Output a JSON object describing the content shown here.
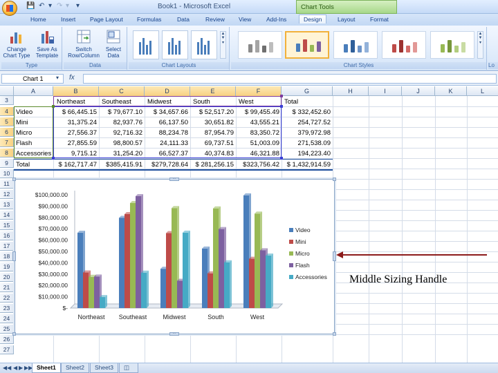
{
  "window": {
    "title": "Book1 - Microsoft Excel",
    "context_tab_group": "Chart Tools"
  },
  "ribbon_tabs": [
    "Home",
    "Insert",
    "Page Layout",
    "Formulas",
    "Data",
    "Review",
    "View",
    "Add-Ins",
    "Design",
    "Layout",
    "Format"
  ],
  "active_tab": "Design",
  "ribbon": {
    "type_group": {
      "label": "Type",
      "change_chart_type": "Change Chart Type",
      "save_as_template": "Save As Template"
    },
    "data_group": {
      "label": "Data",
      "switch_row_column": "Switch Row/Column",
      "select_data": "Select Data"
    },
    "chart_layouts_label": "Chart Layouts",
    "chart_styles_label": "Chart Styles",
    "cut_off_label": "Lo"
  },
  "formula_bar": {
    "name_box": "Chart 1",
    "formula": ""
  },
  "columns": [
    "A",
    "B",
    "C",
    "D",
    "E",
    "F",
    "G",
    "H",
    "I",
    "J",
    "K",
    "L"
  ],
  "rows": [
    "3",
    "4",
    "5",
    "6",
    "7",
    "8",
    "9",
    "10",
    "11",
    "12",
    "13",
    "14",
    "15",
    "16",
    "17",
    "18",
    "19",
    "20",
    "21",
    "22",
    "23",
    "24",
    "25",
    "26",
    "27"
  ],
  "table": {
    "headers": [
      "Northeast",
      "Southeast",
      "Midwest",
      "South",
      "West",
      "Total"
    ],
    "rows": [
      {
        "label": "Video",
        "values": [
          "$  66,445.15",
          "$  79,677.10",
          "$  34,657.66",
          "$  52,517.20",
          "$  99,455.49",
          "$  332,452.60"
        ]
      },
      {
        "label": "Mini",
        "values": [
          "31,375.24",
          "82,937.76",
          "66,137.50",
          "30,651.82",
          "43,555.21",
          "254,727.52"
        ]
      },
      {
        "label": "Micro",
        "values": [
          "27,556.37",
          "92,716.32",
          "88,234.78",
          "87,954.79",
          "83,350.72",
          "379,972.98"
        ]
      },
      {
        "label": "Flash",
        "values": [
          "27,855.59",
          "98,800.57",
          "24,111.33",
          "69,737.51",
          "51,003.09",
          "271,538.09"
        ]
      },
      {
        "label": "Accessories",
        "values": [
          "9,715.12",
          "31,254.20",
          "66,527.37",
          "40,374.83",
          "46,321.88",
          "194,223.40"
        ]
      }
    ],
    "total": {
      "label": "Total",
      "values": [
        "$ 162,717.47",
        "$385,415.91",
        "$279,728.64",
        "$ 281,256.15",
        "$323,756.42",
        "$ 1,432,914.59"
      ]
    }
  },
  "chart_data": {
    "type": "bar",
    "title": "",
    "categories": [
      "Northeast",
      "Southeast",
      "Midwest",
      "South",
      "West"
    ],
    "series": [
      {
        "name": "Video",
        "values": [
          66445.15,
          79677.1,
          34657.66,
          52517.2,
          99455.49
        ],
        "color": "#4a7ebb"
      },
      {
        "name": "Mini",
        "values": [
          31375.24,
          82937.76,
          66137.5,
          30651.82,
          43555.21
        ],
        "color": "#be4b48"
      },
      {
        "name": "Micro",
        "values": [
          27556.37,
          92716.32,
          88234.78,
          87954.79,
          83350.72
        ],
        "color": "#98b954"
      },
      {
        "name": "Flash",
        "values": [
          27855.59,
          98800.57,
          24111.33,
          69737.51,
          51003.09
        ],
        "color": "#7d60a0"
      },
      {
        "name": "Accessories",
        "values": [
          9715.12,
          31254.2,
          66527.37,
          40374.83,
          46321.88
        ],
        "color": "#46aac5"
      }
    ],
    "y_ticks": [
      "$100,000.00",
      "$90,000.00",
      "$80,000.00",
      "$70,000.00",
      "$60,000.00",
      "$50,000.00",
      "$40,000.00",
      "$30,000.00",
      "$20,000.00",
      "$10,000.00",
      "$-"
    ],
    "ylim": [
      0,
      100000
    ],
    "legend_position": "right",
    "grid": false
  },
  "annotation": {
    "text": "Middle Sizing Handle"
  },
  "sheets": [
    "Sheet1",
    "Sheet2",
    "Sheet3"
  ],
  "active_sheet": "Sheet1"
}
